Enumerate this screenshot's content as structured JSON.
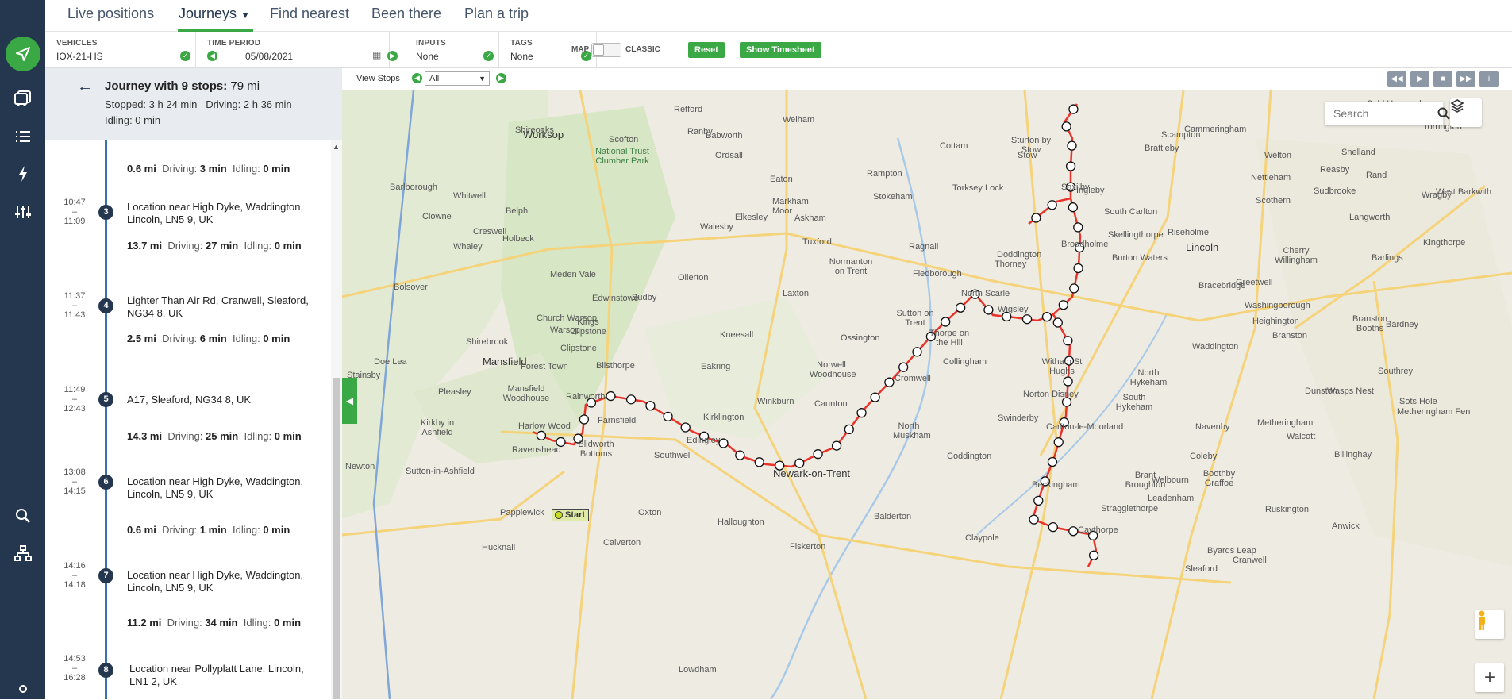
{
  "nav": {
    "tabs": [
      {
        "label": "Live positions"
      },
      {
        "label": "Journeys"
      },
      {
        "label": "Find nearest"
      },
      {
        "label": "Been there"
      },
      {
        "label": "Plan a trip"
      }
    ]
  },
  "filters": {
    "vehicles": {
      "label": "VEHICLES",
      "value": "IOX-21-HS"
    },
    "time_period": {
      "label": "TIME PERIOD",
      "value": "05/08/2021"
    },
    "inputs": {
      "label": "INPUTS",
      "value": "None"
    },
    "tags": {
      "label": "TAGS",
      "value": "None"
    },
    "map_label": "MAP",
    "classic_label": "CLASSIC",
    "reset": "Reset",
    "show_timesheet": "Show Timesheet"
  },
  "journey": {
    "title_prefix": "Journey with 9 stops:",
    "title_distance": "79 mi",
    "stopped": "Stopped: 3 h 24 min",
    "driving": "Driving: 2 h 36 min",
    "idling": "Idling: 0 min"
  },
  "segments": [
    {
      "distance": "0.6 mi",
      "driving_k": "Driving:",
      "driving": "3 min",
      "idling_k": "Idling:",
      "idling": "0 min"
    },
    {
      "distance": "13.7 mi",
      "driving_k": "Driving:",
      "driving": "27 min",
      "idling_k": "Idling:",
      "idling": "0 min"
    },
    {
      "distance": "2.5 mi",
      "driving_k": "Driving:",
      "driving": "6 min",
      "idling_k": "Idling:",
      "idling": "0 min"
    },
    {
      "distance": "14.3 mi",
      "driving_k": "Driving:",
      "driving": "25 min",
      "idling_k": "Idling:",
      "idling": "0 min"
    },
    {
      "distance": "0.6 mi",
      "driving_k": "Driving:",
      "driving": "1 min",
      "idling_k": "Idling:",
      "idling": "0 min"
    },
    {
      "distance": "11.2 mi",
      "driving_k": "Driving:",
      "driving": "34 min",
      "idling_k": "Idling:",
      "idling": "0 min"
    }
  ],
  "stops": [
    {
      "num": "3",
      "start": "10:47",
      "dash": "–",
      "end": "11:09",
      "name": "Location near High Dyke, Waddington, Lincoln, LN5 9, UK"
    },
    {
      "num": "4",
      "start": "11:37",
      "dash": "–",
      "end": "11:43",
      "name": "Lighter Than Air Rd, Cranwell, Sleaford, NG34 8, UK"
    },
    {
      "num": "5",
      "start": "11:49",
      "dash": "–",
      "end": "12:43",
      "name": "A17, Sleaford, NG34 8, UK"
    },
    {
      "num": "6",
      "start": "13:08",
      "dash": "–",
      "end": "14:15",
      "name": "Location near High Dyke, Waddington, Lincoln, LN5 9, UK"
    },
    {
      "num": "7",
      "start": "14:16",
      "dash": "–",
      "end": "14:18",
      "name": "Location near High Dyke, Waddington, Lincoln, LN5 9, UK"
    },
    {
      "num": "8",
      "start": "14:53",
      "dash": "–",
      "end": "16:28",
      "name": "Location near Pollyplatt Lane, Lincoln, LN1 2, UK"
    }
  ],
  "map": {
    "view_stops_label": "View Stops",
    "view_stops_value": "All",
    "search_placeholder": "Search",
    "start_label": "Start",
    "zoom_in": "+",
    "route_color": "#e8332b",
    "places": [
      {
        "name": "Worksop",
        "big": true
      },
      {
        "name": "Mansfield",
        "big": true
      },
      {
        "name": "Newark-on-Trent",
        "big": true
      },
      {
        "name": "Lincoln",
        "big": true
      },
      {
        "name": "Sleaford",
        "big": false
      },
      {
        "name": "National Trust Clumber Park",
        "big": false
      },
      {
        "name": "Retford",
        "big": false
      },
      {
        "name": "Ollerton",
        "big": false
      },
      {
        "name": "Southwell",
        "big": false
      },
      {
        "name": "Collingham",
        "big": false
      },
      {
        "name": "Coddington",
        "big": false
      },
      {
        "name": "Welbourn",
        "big": false
      },
      {
        "name": "Leadenham",
        "big": false
      },
      {
        "name": "Navenby",
        "big": false
      },
      {
        "name": "Bracebridge",
        "big": false
      },
      {
        "name": "Scampton",
        "big": false
      },
      {
        "name": "Waddington",
        "big": false
      },
      {
        "name": "Thorpe on the Hill",
        "big": false
      },
      {
        "name": "Farnsfield",
        "big": false
      },
      {
        "name": "Kirklington",
        "big": false
      },
      {
        "name": "Winkburn",
        "big": false
      },
      {
        "name": "Rainworth",
        "big": false
      },
      {
        "name": "Bilsthorpe",
        "big": false
      },
      {
        "name": "Edingley",
        "big": false
      },
      {
        "name": "Caythorpe",
        "big": false
      },
      {
        "name": "Claypole",
        "big": false
      },
      {
        "name": "Balderton",
        "big": false
      },
      {
        "name": "Fiskerton",
        "big": false
      },
      {
        "name": "Halloughton",
        "big": false
      },
      {
        "name": "Laxton",
        "big": false
      },
      {
        "name": "Tuxford",
        "big": false
      },
      {
        "name": "Walesby",
        "big": false
      },
      {
        "name": "Markham Moor",
        "big": false
      },
      {
        "name": "Saxilby",
        "big": false
      },
      {
        "name": "Skellingthorpe",
        "big": false
      },
      {
        "name": "Doddington",
        "big": false
      },
      {
        "name": "North Scarle",
        "big": false
      },
      {
        "name": "Witham St Hughs",
        "big": false
      },
      {
        "name": "Norton Disney",
        "big": false
      },
      {
        "name": "Carlton-le-Moorland",
        "big": false
      },
      {
        "name": "Brant Broughton",
        "big": false
      },
      {
        "name": "Beckingham",
        "big": false
      },
      {
        "name": "Stragglethorpe",
        "big": false
      },
      {
        "name": "Nettleham",
        "big": false
      },
      {
        "name": "Branston",
        "big": false
      },
      {
        "name": "Metheringham",
        "big": false
      },
      {
        "name": "Ruskington",
        "big": false
      },
      {
        "name": "Anwick",
        "big": false
      },
      {
        "name": "Billinghay",
        "big": false
      },
      {
        "name": "Walcott",
        "big": false
      },
      {
        "name": "Dunston",
        "big": false
      },
      {
        "name": "Blidworth Bottoms",
        "big": false
      },
      {
        "name": "Ravenshead",
        "big": false
      },
      {
        "name": "Harlow Wood",
        "big": false
      },
      {
        "name": "Kirkby in Ashfield",
        "big": false
      },
      {
        "name": "Hucknall",
        "big": false
      },
      {
        "name": "Papplewick",
        "big": false
      },
      {
        "name": "Lowdham",
        "big": false
      },
      {
        "name": "Oxton",
        "big": false
      },
      {
        "name": "Calverton",
        "big": false
      },
      {
        "name": "Edwinstowe",
        "big": false
      },
      {
        "name": "Kings Clipstone",
        "big": false
      },
      {
        "name": "Clipstone",
        "big": false
      },
      {
        "name": "Forest Town",
        "big": false
      },
      {
        "name": "Eakring",
        "big": false
      },
      {
        "name": "Kneesall",
        "big": false
      },
      {
        "name": "Caunton",
        "big": false
      },
      {
        "name": "Cromwell",
        "big": false
      },
      {
        "name": "North Muskham",
        "big": false
      },
      {
        "name": "Sutton on Trent",
        "big": false
      },
      {
        "name": "Normanton on Trent",
        "big": false
      },
      {
        "name": "Norwell Woodhouse",
        "big": false
      },
      {
        "name": "Ossington",
        "big": false
      },
      {
        "name": "Fledborough",
        "big": false
      },
      {
        "name": "Ragnall",
        "big": false
      },
      {
        "name": "Thorney",
        "big": false
      },
      {
        "name": "Wigsley",
        "big": false
      },
      {
        "name": "Broadholme",
        "big": false
      },
      {
        "name": "Ingleby",
        "big": false
      },
      {
        "name": "Torksey Lock",
        "big": false
      },
      {
        "name": "Stokeham",
        "big": false
      },
      {
        "name": "Rampton",
        "big": false
      },
      {
        "name": "Cottam",
        "big": false
      },
      {
        "name": "Eaton",
        "big": false
      },
      {
        "name": "Elkesley",
        "big": false
      },
      {
        "name": "Askham",
        "big": false
      },
      {
        "name": "Welham",
        "big": false
      },
      {
        "name": "Ordsall",
        "big": false
      },
      {
        "name": "Scofton",
        "big": false
      },
      {
        "name": "Ranby",
        "big": false
      },
      {
        "name": "Babworth",
        "big": false
      },
      {
        "name": "Shireoaks",
        "big": false
      },
      {
        "name": "Barlborough",
        "big": false
      },
      {
        "name": "Clowne",
        "big": false
      },
      {
        "name": "Whitwell",
        "big": false
      },
      {
        "name": "Creswell",
        "big": false
      },
      {
        "name": "Whaley",
        "big": false
      },
      {
        "name": "Bolsover",
        "big": false
      },
      {
        "name": "Shirebrook",
        "big": false
      },
      {
        "name": "Meden Vale",
        "big": false
      },
      {
        "name": "Church Warsop",
        "big": false
      },
      {
        "name": "Warsop",
        "big": false
      },
      {
        "name": "Budby",
        "big": false
      },
      {
        "name": "Holbeck",
        "big": false
      },
      {
        "name": "Belph",
        "big": false
      },
      {
        "name": "Pleasley",
        "big": false
      },
      {
        "name": "Mansfield Woodhouse",
        "big": false
      },
      {
        "name": "Sutton-in-Ashfield",
        "big": false
      },
      {
        "name": "Newton",
        "big": false
      },
      {
        "name": "Stainsby",
        "big": false
      },
      {
        "name": "Doe Lea",
        "big": false
      },
      {
        "name": "South Carlton",
        "big": false
      },
      {
        "name": "Burton Waters",
        "big": false
      },
      {
        "name": "Riseholme",
        "big": false
      },
      {
        "name": "North Hykeham",
        "big": false
      },
      {
        "name": "South Hykeham",
        "big": false
      },
      {
        "name": "Swinderby",
        "big": false
      },
      {
        "name": "Coleby",
        "big": false
      },
      {
        "name": "Boothby Graffoe",
        "big": false
      },
      {
        "name": "Byards Leap",
        "big": false
      },
      {
        "name": "Cranwell",
        "big": false
      },
      {
        "name": "Greetwell",
        "big": false
      },
      {
        "name": "Washingborough",
        "big": false
      },
      {
        "name": "Heighington",
        "big": false
      },
      {
        "name": "Cherry Willingham",
        "big": false
      },
      {
        "name": "Sudbrooke",
        "big": false
      },
      {
        "name": "Langworth",
        "big": false
      },
      {
        "name": "Barlings",
        "big": false
      },
      {
        "name": "Welton",
        "big": false
      },
      {
        "name": "Snelland",
        "big": false
      },
      {
        "name": "Reasby",
        "big": false
      },
      {
        "name": "Rand",
        "big": false
      },
      {
        "name": "West Barkwith",
        "big": false
      },
      {
        "name": "Wragby",
        "big": false
      },
      {
        "name": "Kingthorpe",
        "big": false
      },
      {
        "name": "Bardney",
        "big": false
      },
      {
        "name": "Southrey",
        "big": false
      },
      {
        "name": "Wasps Nest",
        "big": false
      },
      {
        "name": "Sots Hole",
        "big": false
      },
      {
        "name": "Metheringham Fen",
        "big": false
      },
      {
        "name": "Scothern",
        "big": false
      },
      {
        "name": "Cammeringham",
        "big": false
      },
      {
        "name": "Brattleby",
        "big": false
      },
      {
        "name": "Cold Hanworth",
        "big": false
      },
      {
        "name": "Torrington",
        "big": false
      },
      {
        "name": "Stow",
        "big": false
      },
      {
        "name": "Sturton by Stow",
        "big": false
      },
      {
        "name": "Branston Booths",
        "big": false
      },
      {
        "name": "Heighington",
        "big": false
      }
    ]
  }
}
